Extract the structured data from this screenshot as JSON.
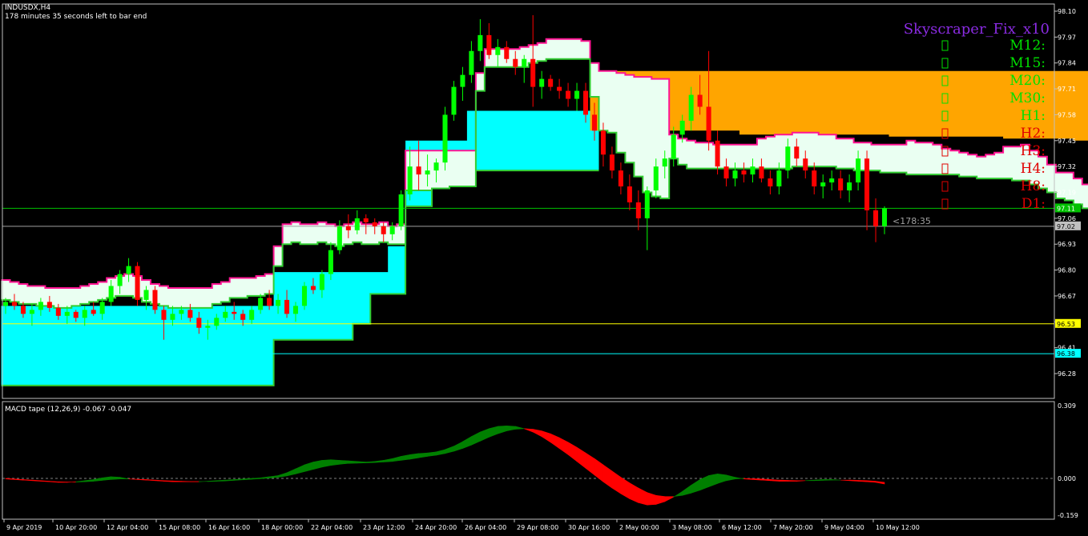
{
  "header": {
    "symbol": "INDUSDX,H4",
    "timer": "178 minutes 35 seconds left to bar end"
  },
  "indicator_panel": {
    "title": "Skyscraper_Fix_x10",
    "title_color": "#8a2be2",
    "rows": [
      {
        "label": "M12:",
        "color": "#00e000",
        "icon": "box-icon"
      },
      {
        "label": "M15:",
        "color": "#00e000",
        "icon": "box-icon"
      },
      {
        "label": "M20:",
        "color": "#00e000",
        "icon": "box-icon"
      },
      {
        "label": "M30:",
        "color": "#00e000",
        "icon": "box-icon"
      },
      {
        "label": "H1:",
        "color": "#00e000",
        "icon": "box-icon"
      },
      {
        "label": "H2:",
        "color": "#e00000",
        "icon": "box-icon"
      },
      {
        "label": "H3:",
        "color": "#e00000",
        "icon": "box-icon"
      },
      {
        "label": "H4:",
        "color": "#e00000",
        "icon": "box-icon"
      },
      {
        "label": "H8:",
        "color": "#e00000",
        "icon": "box-icon"
      },
      {
        "label": "D1:",
        "color": "#e00000",
        "icon": "box-icon"
      }
    ]
  },
  "countdown_label": "<178:35",
  "price_badges": [
    {
      "label": "97.11",
      "bg": "#00c000",
      "fg": "#ffffff",
      "value": 97.11
    },
    {
      "label": "97.02",
      "bg": "#c0c0c0",
      "fg": "#000000",
      "value": 97.02
    },
    {
      "label": "96.53",
      "bg": "#ffff00",
      "fg": "#000000",
      "value": 96.53
    },
    {
      "label": "96.38",
      "bg": "#00ffff",
      "fg": "#000000",
      "value": 96.38
    }
  ],
  "macd": {
    "label": "MACD tape (12,26,9) -0.067 -0.047",
    "y_ticks": [
      "0.309",
      "0.000",
      "-0.159"
    ],
    "up_color": "#008000",
    "down_color": "#ff0000"
  },
  "colors": {
    "bull_candle": "#00ff00",
    "bear_candle": "#ff0000",
    "upper_band_edge": "#ff1493",
    "lower_band_edge": "#32cd32",
    "cloud_cyan": "#00ffff",
    "cloud_orange": "#ffa500"
  },
  "chart_data": {
    "type": "candlestick",
    "title": "",
    "y_ticks": [
      "98.10",
      "97.97",
      "97.84",
      "97.71",
      "97.58",
      "97.45",
      "97.32",
      "97.19",
      "97.06",
      "96.93",
      "96.80",
      "96.67",
      "96.54",
      "96.41",
      "96.28"
    ],
    "ylim": [
      96.18,
      98.12
    ],
    "x_labels": [
      "9 Apr 2019",
      "10 Apr 20:00",
      "12 Apr 04:00",
      "15 Apr 08:00",
      "16 Apr 16:00",
      "18 Apr 00:00",
      "22 Apr 04:00",
      "23 Apr 12:00",
      "24 Apr 20:00",
      "26 Apr 04:00",
      "29 Apr 08:00",
      "30 Apr 16:00",
      "2 May 00:00",
      "3 May 08:00",
      "6 May 12:00",
      "7 May 20:00",
      "9 May 04:00",
      "10 May 12:00"
    ],
    "horizontal_lines": [
      97.11,
      97.02,
      96.53,
      96.38
    ],
    "bands": {
      "upper": [
        96.75,
        96.74,
        96.73,
        96.72,
        96.72,
        96.71,
        96.71,
        96.71,
        96.71,
        96.72,
        96.73,
        96.74,
        96.76,
        96.77,
        96.78,
        96.77,
        96.75,
        96.73,
        96.72,
        96.71,
        96.71,
        96.71,
        96.71,
        96.71,
        96.73,
        96.74,
        96.76,
        96.76,
        96.76,
        96.77,
        96.78,
        96.92,
        97.03,
        97.04,
        97.03,
        97.03,
        97.04,
        97.03,
        97.02,
        97.03,
        97.04,
        97.03,
        97.03,
        97.04,
        97.02,
        97.03,
        97.4,
        97.4,
        97.4,
        97.4,
        97.4,
        97.4,
        97.4,
        97.4,
        97.79,
        97.91,
        97.91,
        97.91,
        97.91,
        97.92,
        97.93,
        97.94,
        97.96,
        97.96,
        97.96,
        97.96,
        97.95,
        97.84,
        97.8,
        97.8,
        97.79,
        97.78,
        97.77,
        97.77,
        97.76,
        97.76,
        97.48,
        97.46,
        97.45,
        97.44,
        97.44,
        97.43,
        97.43,
        97.43,
        97.43,
        97.43,
        97.46,
        97.47,
        97.48,
        97.48,
        97.49,
        97.49,
        97.49,
        97.48,
        97.48,
        97.46,
        97.46,
        97.44,
        97.44,
        97.43,
        97.43,
        97.43,
        97.43,
        97.45,
        97.44,
        97.44,
        97.43,
        97.41,
        97.4,
        97.39,
        97.38,
        97.37,
        97.38,
        97.39,
        97.42,
        97.42,
        97.43,
        97.4,
        97.37,
        97.33,
        97.29,
        97.29,
        97.26,
        97.23
      ],
      "lower": [
        96.65,
        96.64,
        96.63,
        96.63,
        96.62,
        96.62,
        96.61,
        96.61,
        96.62,
        96.63,
        96.64,
        96.65,
        96.66,
        96.67,
        96.67,
        96.66,
        96.64,
        96.63,
        96.62,
        96.61,
        96.61,
        96.61,
        96.61,
        96.61,
        96.63,
        96.64,
        96.66,
        96.66,
        96.67,
        96.67,
        96.68,
        96.82,
        96.93,
        96.94,
        96.93,
        96.93,
        96.94,
        96.93,
        96.92,
        96.93,
        96.94,
        96.93,
        96.93,
        96.94,
        96.93,
        96.93,
        97.2,
        97.2,
        97.2,
        97.21,
        97.21,
        97.22,
        97.22,
        97.22,
        97.7,
        97.82,
        97.82,
        97.82,
        97.82,
        97.82,
        97.84,
        97.85,
        97.86,
        97.86,
        97.86,
        97.86,
        97.86,
        97.67,
        97.5,
        97.49,
        97.39,
        97.34,
        97.27,
        97.19,
        97.17,
        97.16,
        97.36,
        97.33,
        97.31,
        97.31,
        97.31,
        97.31,
        97.31,
        97.31,
        97.31,
        97.31,
        97.31,
        97.31,
        97.31,
        97.31,
        97.32,
        97.32,
        97.32,
        97.32,
        97.32,
        97.31,
        97.31,
        97.3,
        97.3,
        97.3,
        97.29,
        97.29,
        97.29,
        97.28,
        97.28,
        97.28,
        97.28,
        97.28,
        97.28,
        97.27,
        97.27,
        97.26,
        97.26,
        97.26,
        97.26,
        97.25,
        97.25,
        97.23,
        97.21,
        97.19,
        97.16,
        97.15,
        97.13,
        97.11
      ]
    },
    "cyan_cloud": {
      "top": [
        96.62,
        96.62,
        96.62,
        96.62,
        96.62,
        96.62,
        96.62,
        96.62,
        96.62,
        96.62,
        96.62,
        96.62,
        96.62,
        96.62,
        96.62,
        96.62,
        96.62,
        96.62,
        96.62,
        96.62,
        96.62,
        96.62,
        96.62,
        96.62,
        96.62,
        96.62,
        96.62,
        96.62,
        96.62,
        96.62,
        96.62,
        96.79,
        96.79,
        96.79,
        96.79,
        96.79,
        96.79,
        96.79,
        96.79,
        96.79,
        96.79,
        96.79,
        96.79,
        96.79,
        96.92,
        96.92,
        97.45,
        97.45,
        97.45,
        97.45,
        97.45,
        97.45,
        97.45,
        97.6,
        97.6,
        97.6,
        97.6,
        97.6,
        97.6,
        97.6,
        97.6,
        97.6,
        97.6,
        97.6,
        97.6,
        97.6,
        97.6,
        97.6
      ],
      "bottom": [
        96.22,
        96.22,
        96.22,
        96.22,
        96.22,
        96.22,
        96.22,
        96.22,
        96.22,
        96.22,
        96.22,
        96.22,
        96.22,
        96.22,
        96.22,
        96.22,
        96.22,
        96.22,
        96.22,
        96.22,
        96.22,
        96.22,
        96.22,
        96.22,
        96.22,
        96.22,
        96.22,
        96.22,
        96.22,
        96.22,
        96.22,
        96.45,
        96.45,
        96.45,
        96.45,
        96.45,
        96.45,
        96.45,
        96.45,
        96.45,
        96.53,
        96.53,
        96.68,
        96.68,
        96.68,
        96.68,
        97.12,
        97.12,
        97.12,
        97.23,
        97.23,
        97.23,
        97.23,
        97.3,
        97.3,
        97.3,
        97.3,
        97.3,
        97.3,
        97.3,
        97.3,
        97.3,
        97.3,
        97.3,
        97.3,
        97.3,
        97.3,
        97.3
      ]
    },
    "orange_cloud": {
      "start_index": 67,
      "top": [
        97.8,
        97.8,
        97.8,
        97.8,
        97.8,
        97.8,
        97.8,
        97.8,
        97.8,
        97.8,
        97.8,
        97.8,
        97.8,
        97.8,
        97.8,
        97.8,
        97.8,
        97.8,
        97.8,
        97.8,
        97.8,
        97.8,
        97.8,
        97.8,
        97.8,
        97.8,
        97.8,
        97.8,
        97.8,
        97.8,
        97.8,
        97.8,
        97.8,
        97.8,
        97.8,
        97.8,
        97.8,
        97.8,
        97.8,
        97.8,
        97.8,
        97.8,
        97.8,
        97.8,
        97.8,
        97.8,
        97.8,
        97.8,
        97.8,
        97.8,
        97.8,
        97.8,
        97.8,
        97.8,
        97.8,
        97.8,
        97.8,
        97.8,
        97.8,
        97.8,
        97.8,
        97.76,
        97.76,
        97.76,
        97.76,
        97.76,
        97.76,
        97.76
      ],
      "bottom": [
        97.5,
        97.5,
        97.5,
        97.5,
        97.5,
        97.5,
        97.5,
        97.5,
        97.5,
        97.5,
        97.5,
        97.5,
        97.5,
        97.5,
        97.5,
        97.5,
        97.5,
        97.48,
        97.48,
        97.48,
        97.48,
        97.48,
        97.48,
        97.48,
        97.48,
        97.48,
        97.48,
        97.48,
        97.48,
        97.48,
        97.48,
        97.48,
        97.48,
        97.48,
        97.47,
        97.47,
        97.47,
        97.47,
        97.47,
        97.47,
        97.47,
        97.47,
        97.47,
        97.47,
        97.47,
        97.47,
        97.47,
        97.46,
        97.46,
        97.46,
        97.46,
        97.46,
        97.46,
        97.46,
        97.46,
        97.45,
        97.45,
        97.45,
        97.45,
        97.45,
        97.45,
        97.44,
        97.44,
        97.44,
        97.44,
        97.44,
        97.44,
        97.44
      ]
    },
    "candles": [
      [
        96.62,
        96.66,
        96.58,
        96.64
      ],
      [
        96.64,
        96.68,
        96.6,
        96.62
      ],
      [
        96.62,
        96.64,
        96.56,
        96.58
      ],
      [
        96.58,
        96.63,
        96.52,
        96.6
      ],
      [
        96.6,
        96.66,
        96.57,
        96.64
      ],
      [
        96.64,
        96.67,
        96.59,
        96.61
      ],
      [
        96.61,
        96.63,
        96.55,
        96.57
      ],
      [
        96.57,
        96.62,
        96.53,
        96.59
      ],
      [
        96.59,
        96.6,
        96.54,
        96.56
      ],
      [
        96.56,
        96.62,
        96.52,
        96.6
      ],
      [
        96.6,
        96.64,
        96.57,
        96.58
      ],
      [
        96.58,
        96.66,
        96.55,
        96.64
      ],
      [
        96.64,
        96.75,
        96.62,
        96.72
      ],
      [
        96.72,
        96.8,
        96.68,
        96.78
      ],
      [
        96.78,
        96.86,
        96.74,
        96.82
      ],
      [
        96.82,
        96.84,
        96.62,
        96.65
      ],
      [
        96.65,
        96.72,
        96.6,
        96.7
      ],
      [
        96.7,
        96.72,
        96.58,
        96.6
      ],
      [
        96.6,
        96.62,
        96.45,
        96.55
      ],
      [
        96.55,
        96.62,
        96.52,
        96.58
      ],
      [
        96.58,
        96.62,
        96.55,
        96.6
      ],
      [
        96.6,
        96.63,
        96.54,
        96.56
      ],
      [
        96.56,
        96.59,
        96.48,
        96.51
      ],
      [
        96.51,
        96.55,
        96.45,
        96.52
      ],
      [
        96.52,
        96.58,
        96.5,
        96.56
      ],
      [
        96.56,
        96.62,
        96.54,
        96.59
      ],
      [
        96.59,
        96.64,
        96.55,
        96.58
      ],
      [
        96.58,
        96.6,
        96.52,
        96.55
      ],
      [
        96.55,
        96.62,
        96.53,
        96.6
      ],
      [
        96.6,
        96.68,
        96.58,
        96.66
      ],
      [
        96.66,
        96.7,
        96.6,
        96.62
      ],
      [
        96.62,
        96.68,
        96.58,
        96.65
      ],
      [
        96.65,
        96.7,
        96.56,
        96.58
      ],
      [
        96.58,
        96.64,
        96.54,
        96.62
      ],
      [
        96.62,
        96.74,
        96.6,
        96.72
      ],
      [
        96.72,
        96.76,
        96.68,
        96.7
      ],
      [
        96.7,
        96.8,
        96.66,
        96.78
      ],
      [
        96.78,
        96.94,
        96.75,
        96.9
      ],
      [
        96.9,
        97.05,
        96.88,
        97.02
      ],
      [
        97.02,
        97.08,
        96.96,
        97.0
      ],
      [
        97.0,
        97.1,
        96.98,
        97.06
      ],
      [
        97.06,
        97.08,
        96.98,
        97.04
      ],
      [
        97.04,
        97.06,
        96.98,
        97.02
      ],
      [
        97.02,
        97.04,
        96.94,
        96.98
      ],
      [
        96.98,
        97.04,
        96.95,
        97.02
      ],
      [
        97.02,
        97.2,
        97.0,
        97.18
      ],
      [
        97.18,
        97.42,
        97.15,
        97.32
      ],
      [
        97.32,
        97.45,
        97.2,
        97.28
      ],
      [
        97.28,
        97.38,
        97.22,
        97.3
      ],
      [
        97.3,
        97.36,
        97.24,
        97.34
      ],
      [
        97.34,
        97.62,
        97.3,
        97.58
      ],
      [
        97.58,
        97.75,
        97.55,
        97.72
      ],
      [
        97.72,
        97.82,
        97.65,
        97.78
      ],
      [
        97.78,
        97.95,
        97.74,
        97.9
      ],
      [
        97.9,
        98.06,
        97.85,
        97.98
      ],
      [
        97.98,
        98.04,
        97.86,
        97.88
      ],
      [
        97.88,
        97.96,
        97.82,
        97.92
      ],
      [
        97.92,
        97.95,
        97.84,
        97.86
      ],
      [
        97.86,
        97.9,
        97.78,
        97.82
      ],
      [
        97.82,
        97.88,
        97.74,
        97.86
      ],
      [
        97.86,
        98.08,
        97.62,
        97.72
      ],
      [
        97.72,
        97.8,
        97.66,
        97.76
      ],
      [
        97.76,
        97.78,
        97.7,
        97.72
      ],
      [
        97.72,
        97.76,
        97.66,
        97.7
      ],
      [
        97.7,
        97.74,
        97.62,
        97.66
      ],
      [
        97.66,
        97.74,
        97.6,
        97.7
      ],
      [
        97.7,
        97.74,
        97.54,
        97.58
      ],
      [
        97.58,
        97.64,
        97.45,
        97.5
      ],
      [
        97.5,
        97.54,
        97.32,
        97.38
      ],
      [
        97.38,
        97.42,
        97.26,
        97.3
      ],
      [
        97.3,
        97.34,
        97.18,
        97.22
      ],
      [
        97.22,
        97.28,
        97.1,
        97.14
      ],
      [
        97.14,
        97.2,
        97.0,
        97.06
      ],
      [
        97.06,
        97.22,
        96.9,
        97.2
      ],
      [
        97.2,
        97.36,
        97.16,
        97.32
      ],
      [
        97.32,
        97.4,
        97.26,
        97.36
      ],
      [
        97.36,
        97.52,
        97.32,
        97.48
      ],
      [
        97.48,
        97.58,
        97.44,
        97.55
      ],
      [
        97.55,
        97.72,
        97.5,
        97.68
      ],
      [
        97.68,
        97.78,
        97.58,
        97.62
      ],
      [
        97.62,
        97.9,
        97.4,
        97.45
      ],
      [
        97.45,
        97.5,
        97.28,
        97.32
      ],
      [
        97.32,
        97.36,
        97.22,
        97.26
      ],
      [
        97.26,
        97.34,
        97.22,
        97.3
      ],
      [
        97.3,
        97.34,
        97.24,
        97.28
      ],
      [
        97.28,
        97.36,
        97.24,
        97.32
      ],
      [
        97.32,
        97.36,
        97.24,
        97.26
      ],
      [
        97.26,
        97.3,
        97.18,
        97.22
      ],
      [
        97.22,
        97.34,
        97.18,
        97.3
      ],
      [
        97.3,
        97.46,
        97.26,
        97.42
      ],
      [
        97.42,
        97.46,
        97.32,
        97.36
      ],
      [
        97.36,
        97.4,
        97.26,
        97.3
      ],
      [
        97.3,
        97.34,
        97.18,
        97.22
      ],
      [
        97.22,
        97.28,
        97.16,
        97.24
      ],
      [
        97.24,
        97.3,
        97.2,
        97.26
      ],
      [
        97.26,
        97.3,
        97.16,
        97.2
      ],
      [
        97.2,
        97.28,
        97.14,
        97.24
      ],
      [
        97.24,
        97.4,
        97.2,
        97.36
      ],
      [
        97.36,
        97.4,
        97.0,
        97.1
      ],
      [
        97.1,
        97.16,
        96.94,
        97.02
      ],
      [
        97.02,
        97.12,
        96.98,
        97.11
      ]
    ]
  }
}
